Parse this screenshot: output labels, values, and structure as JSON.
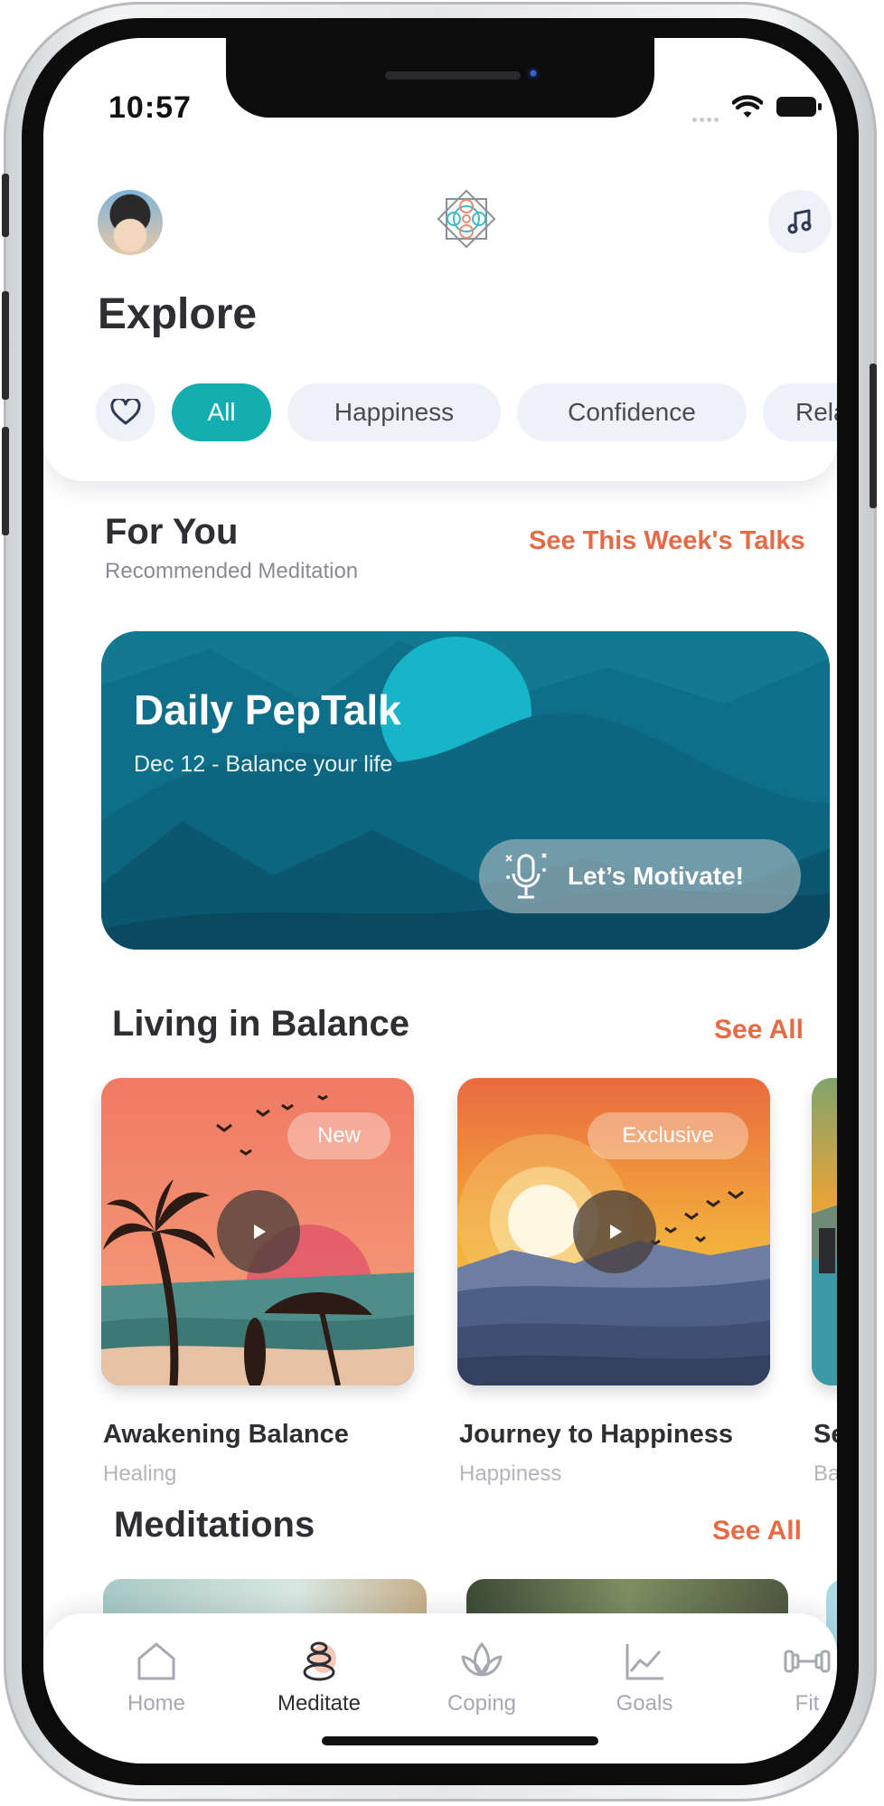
{
  "status_bar": {
    "time": "10:57"
  },
  "header": {
    "title": "Explore"
  },
  "filters": {
    "chips": [
      {
        "label": "All",
        "active": true
      },
      {
        "label": "Happiness",
        "active": false
      },
      {
        "label": "Confidence",
        "active": false
      },
      {
        "label": "Relax",
        "active": false
      }
    ]
  },
  "for_you": {
    "title": "For You",
    "subtitle": "Recommended Meditation",
    "link": "See This Week's Talks",
    "pep": {
      "title": "Daily PepTalk",
      "subtitle": "Dec 12 - Balance your life",
      "button": "Let’s Motivate!"
    }
  },
  "living_in_balance": {
    "title": "Living in Balance",
    "link": "See All",
    "cards": [
      {
        "title": "Awakening Balance",
        "category": "Healing",
        "badge": "New"
      },
      {
        "title": "Journey to Happiness",
        "category": "Happiness",
        "badge": "Exclusive"
      },
      {
        "title": "Secr",
        "category": "Balan",
        "badge": ""
      }
    ]
  },
  "meditations": {
    "title": "Meditations",
    "link": "See All"
  },
  "tabbar": {
    "items": [
      {
        "label": "Home",
        "icon": "home-icon",
        "active": false
      },
      {
        "label": "Meditate",
        "icon": "meditate-stones-icon",
        "active": true
      },
      {
        "label": "Coping",
        "icon": "lotus-icon",
        "active": false
      },
      {
        "label": "Goals",
        "icon": "chart-line-icon",
        "active": false
      },
      {
        "label": "Fit",
        "icon": "dumbbell-icon",
        "active": false
      }
    ]
  },
  "colors": {
    "accent": "#14aeb1",
    "link": "#e56b47",
    "pep_background": "#106b86",
    "text_primary": "#2e2e33"
  }
}
